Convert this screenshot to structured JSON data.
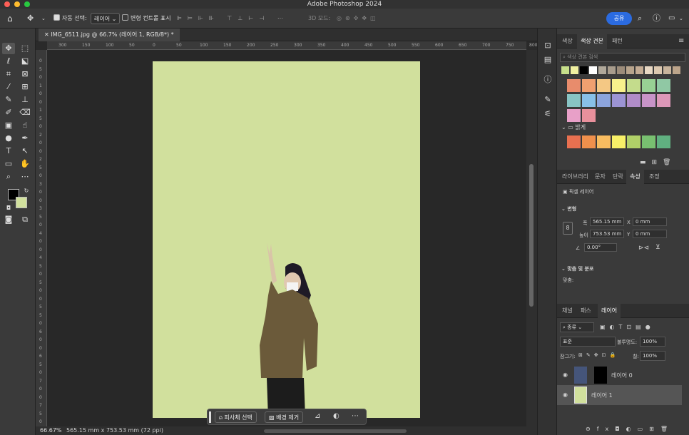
{
  "app": {
    "window_title": "Adobe Photoshop 2024"
  },
  "optionsbar": {
    "auto_select_label": "자동 선택:",
    "auto_select_value": "레이어",
    "transform_label": "변형 컨트롤 표시",
    "mode3d_label": "3D 모드:",
    "share_label": "공유"
  },
  "document": {
    "tab_title": "IMG_6511.jpg @ 66.7% (레이어 1, RGB/8*) *",
    "background_color": "#d1e09d"
  },
  "rulers": {
    "h": [
      "300",
      "150",
      "100",
      "50",
      "0",
      "50",
      "100",
      "150",
      "200",
      "250",
      "300",
      "350",
      "400",
      "450",
      "500",
      "550",
      "600",
      "650",
      "700",
      "750",
      "800",
      "850",
      "900",
      "950"
    ],
    "v": [
      "0",
      "5",
      "0",
      "1",
      "0",
      "0",
      "1",
      "5",
      "0",
      "2",
      "0",
      "0",
      "2",
      "5",
      "0",
      "3",
      "0",
      "0",
      "3",
      "5",
      "0",
      "4",
      "0",
      "0",
      "4",
      "5",
      "0",
      "5",
      "0",
      "0",
      "5",
      "5",
      "0",
      "6",
      "0",
      "0",
      "6",
      "5",
      "0",
      "7",
      "0",
      "0",
      "7",
      "5",
      "0"
    ]
  },
  "context_bar": {
    "select_subject": "피사체 선택",
    "remove_bg": "배경 제거"
  },
  "status": {
    "zoom": "66.67%",
    "dimensions": "565.15 mm x 753.53 mm (72 ppi)"
  },
  "swatches_panel": {
    "tabs": [
      "색상",
      "색상 견본",
      "패턴"
    ],
    "search_placeholder": "색상 견본 검색",
    "recent": [
      "#c7df8a",
      "#f0f0a0",
      "#000000",
      "#ffffff",
      "#b0a89a",
      "#a89c8c",
      "#9c8c7a",
      "#b8a48c",
      "#c4ac94",
      "#e8d8c4",
      "#dcc8b0",
      "#c8b49c",
      "#bca48a"
    ],
    "grid": [
      "#e88c6c",
      "#f0a070",
      "#f4c884",
      "#f8f08c",
      "#c4dc8c",
      "#98d094",
      "#90c8a4",
      "#88c4c4",
      "#88c0e8",
      "#8ca4dc",
      "#9c94d4",
      "#b08cc8",
      "#c894c8",
      "#dc98b8",
      "#e8a0c8",
      "#e8909c"
    ],
    "group_label": "밝게",
    "group_colors": [
      "#e87050",
      "#f0904c",
      "#f8bc60",
      "#f8f068",
      "#b0d068",
      "#78c070",
      "#60b080"
    ]
  },
  "properties_panel": {
    "tabs": [
      "라이브러리",
      "문자",
      "단락",
      "속성",
      "조정"
    ],
    "kind": "픽셀 레이어",
    "section_transform": "변형",
    "w_label": "폭",
    "w_value": "565.15 mm",
    "x_label": "X",
    "x_value": "0 mm",
    "h_label": "높이",
    "h_value": "753.53 mm",
    "y_label": "Y",
    "y_value": "0 mm",
    "angle_value": "0.00°",
    "section_align": "맞춤 및 분포",
    "align_label": "맞춤:"
  },
  "layers_panel": {
    "tabs": [
      "채널",
      "패스",
      "레이어"
    ],
    "filter": "종류",
    "blend": "표준",
    "opacity_label": "불투명도:",
    "opacity_value": "100%",
    "lock_label": "잠그기:",
    "fill_label": "칠:",
    "fill_value": "100%",
    "layers": [
      {
        "name": "레이어 0"
      },
      {
        "name": "레이어 1"
      }
    ]
  }
}
